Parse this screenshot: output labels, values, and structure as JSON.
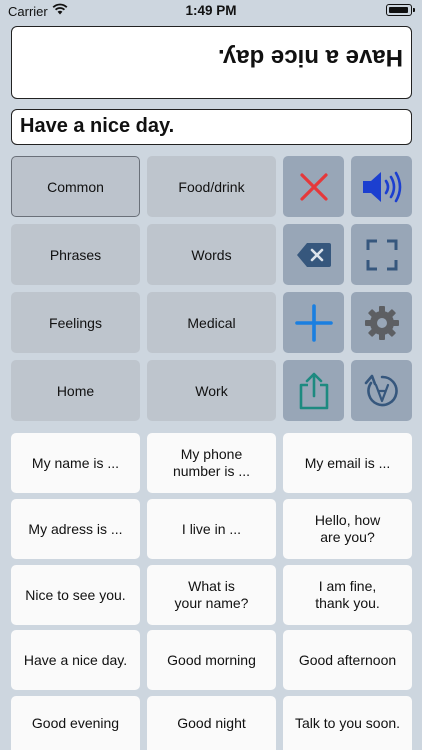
{
  "status": {
    "carrier": "Carrier",
    "time": "1:49 PM"
  },
  "display": {
    "flipped_text": "Have a nice day.",
    "text": "Have a nice day."
  },
  "categories": [
    {
      "label": "Common",
      "selected": true
    },
    {
      "label": "Food/drink",
      "selected": false
    },
    {
      "label": "Phrases",
      "selected": false
    },
    {
      "label": "Words",
      "selected": false
    },
    {
      "label": "Feelings",
      "selected": false
    },
    {
      "label": "Medical",
      "selected": false
    },
    {
      "label": "Home",
      "selected": false
    },
    {
      "label": "Work",
      "selected": false
    }
  ],
  "tools": {
    "clear": "close-icon",
    "speak": "speaker-icon",
    "backspace": "backspace-icon",
    "fullscreen": "fullscreen-icon",
    "add": "plus-icon",
    "settings": "gear-icon",
    "share": "share-icon",
    "flip": "rotate-text-icon"
  },
  "phrases": [
    "My name is ...",
    "My phone\nnumber is ...",
    "My email is ...",
    "My adress is ...",
    "I live in ...",
    "Hello, how\nare you?",
    "Nice to see you.",
    "What is\nyour name?",
    "I am fine,\nthank you.",
    "Have a nice day.",
    "Good morning",
    "Good afternoon",
    "Good evening",
    "Good night",
    "Talk to you soon."
  ],
  "colors": {
    "background": "#cdd6df",
    "category_button": "#bec5cd",
    "tool_button": "#98a6b7",
    "phrase_button": "#fafafa",
    "clear_red": "#e5383b",
    "speak_blue": "#1c3fd0",
    "steel_blue": "#36577d",
    "add_blue": "#1a7fe0",
    "gear_gray": "#5d5f63",
    "share_teal": "#1d8a80"
  }
}
